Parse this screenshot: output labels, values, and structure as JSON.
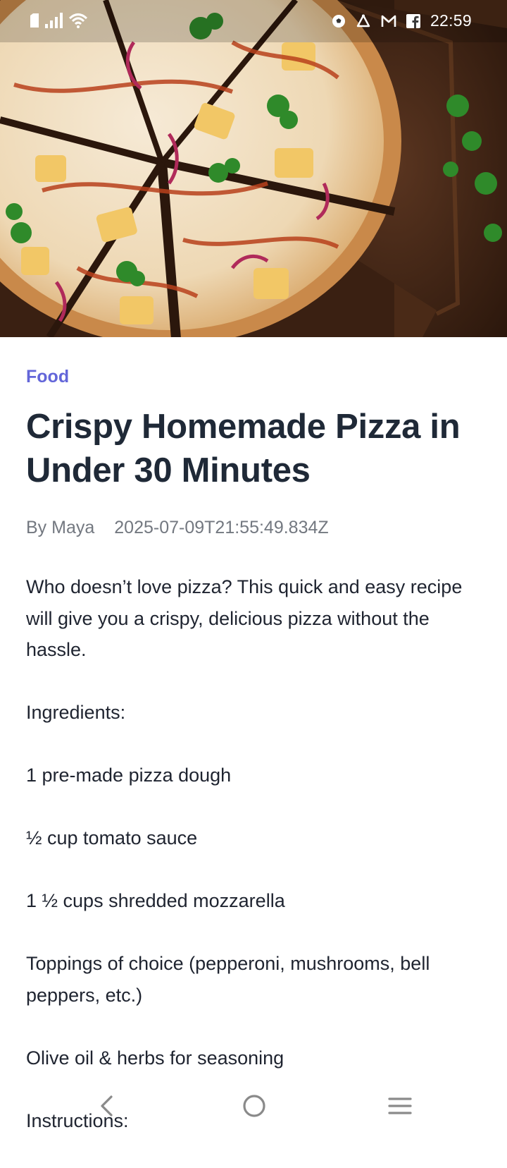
{
  "status_bar": {
    "time": "22:59",
    "icons": [
      "sim-icon",
      "signal-icon",
      "wifi-icon",
      "soccer-ball-icon",
      "alarm-icon",
      "gmail-icon",
      "facebook-icon"
    ]
  },
  "hero": {
    "image_alt": "pizza-photo"
  },
  "article": {
    "category": "Food",
    "title": "Crispy Homemade Pizza in Under 30 Minutes",
    "author": "By Maya",
    "date": "2025-07-09T21:55:49.834Z",
    "paragraphs": [
      "Who doesn’t love pizza? This quick and easy recipe will give you a crispy, delicious pizza without the hassle.",
      "Ingredients:",
      "1 pre-made pizza dough",
      "½ cup tomato sauce",
      "1 ½ cups shredded mozzarella",
      "Toppings of choice (pepperoni, mushrooms, bell peppers, etc.)",
      "Olive oil & herbs for seasoning",
      "Instructions:"
    ]
  },
  "nav_bar": {
    "buttons": [
      "back-icon",
      "home-icon",
      "menu-icon"
    ]
  },
  "colors": {
    "accent": "#6366d9",
    "title": "#1f2937",
    "meta": "#737880",
    "body": "#1f2430",
    "nav_icon": "#8a8a8a"
  }
}
